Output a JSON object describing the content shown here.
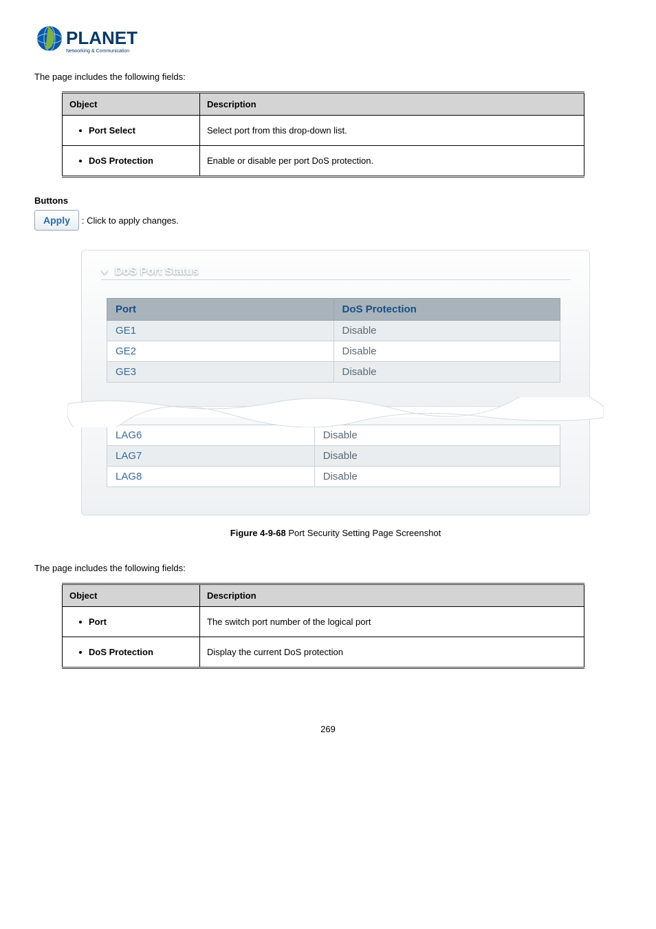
{
  "logo": {
    "brand": "PLANET",
    "tagline": "Networking & Communication"
  },
  "intro1": "The page includes the following fields:",
  "table1": {
    "header_object": "Object",
    "header_description": "Description",
    "rows": [
      {
        "object": "Port Select",
        "description": "Select port from this drop-down list."
      },
      {
        "object": "DoS Protection",
        "description": "Enable or disable per port DoS protection."
      }
    ]
  },
  "buttons_heading": "Buttons",
  "apply_label": "Apply",
  "apply_desc": ": Click to apply changes.",
  "panel_title": "DoS Port Status",
  "port_header_port": "Port",
  "port_header_dos": "DoS Protection",
  "port_rows_top": [
    {
      "port": "GE1",
      "dos": "Disable",
      "alt": true
    },
    {
      "port": "GE2",
      "dos": "Disable",
      "alt": false
    },
    {
      "port": "GE3",
      "dos": "Disable",
      "alt": true
    }
  ],
  "port_rows_bottom": [
    {
      "port": "LAG6",
      "dos": "Disable",
      "alt": false
    },
    {
      "port": "LAG7",
      "dos": "Disable",
      "alt": true
    },
    {
      "port": "LAG8",
      "dos": "Disable",
      "alt": false
    }
  ],
  "caption_bold": "Figure 4-9-68",
  "caption_rest": " Port Security Setting Page Screenshot",
  "intro2": "The page includes the following fields:",
  "table2": {
    "header_object": "Object",
    "header_description": "Description",
    "rows": [
      {
        "object": "Port",
        "description": "The switch port number of the logical port"
      },
      {
        "object": "DoS Protection",
        "description": "Display the current DoS protection"
      }
    ]
  },
  "page_number": "269"
}
